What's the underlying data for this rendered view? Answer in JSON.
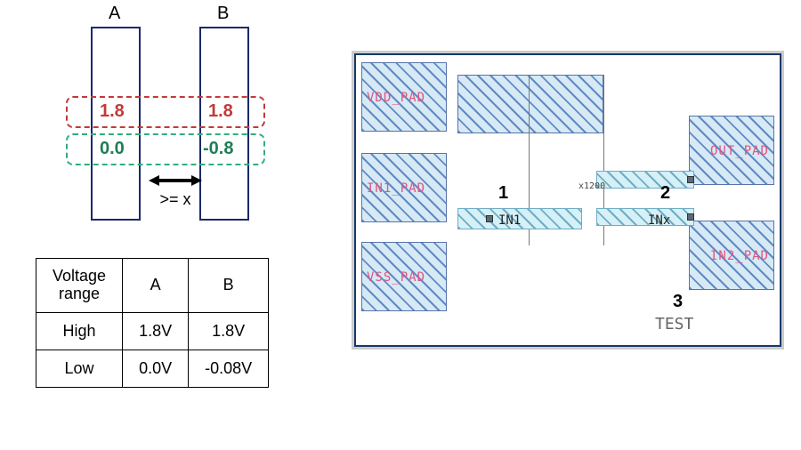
{
  "left": {
    "colA": "A",
    "colB": "B",
    "highA": "1.8",
    "highB": "1.8",
    "lowA": "0.0",
    "lowB": "-0.8",
    "arrowLabel": ">= x"
  },
  "table": {
    "header": {
      "range": "Voltage\nrange",
      "a": "A",
      "b": "B"
    },
    "rows": [
      {
        "label": "High",
        "a": "1.8V",
        "b": "1.8V"
      },
      {
        "label": "Low",
        "a": "0.0V",
        "b": "-0.08V"
      }
    ]
  },
  "right": {
    "pads": {
      "vdd": "VDD_PAD",
      "in1": "IN1_PAD",
      "vss": "VSS_PAD",
      "out": "OUT_PAD",
      "in2": "IN2_PAD"
    },
    "nets": {
      "in1": "IN1",
      "inx": "INx"
    },
    "nums": {
      "n1": "1",
      "n2": "2",
      "n3": "3"
    },
    "cell": "x1200",
    "test": "TEST"
  }
}
